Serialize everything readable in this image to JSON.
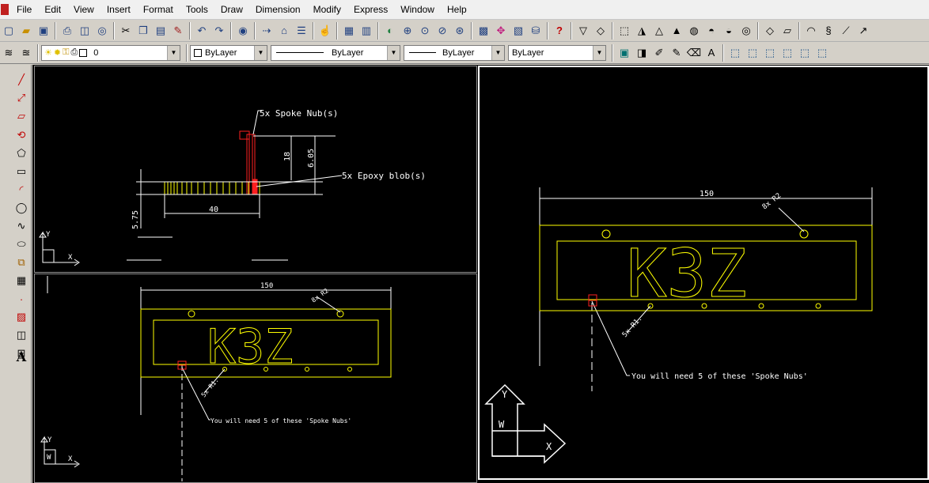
{
  "menu": [
    "File",
    "Edit",
    "View",
    "Insert",
    "Format",
    "Tools",
    "Draw",
    "Dimension",
    "Modify",
    "Express",
    "Window",
    "Help"
  ],
  "toolbar_icons": [
    "new-icon",
    "open-icon",
    "save-icon",
    "plot-icon",
    "preview-icon",
    "publish-icon",
    "cut-icon",
    "copy-icon",
    "paste-icon",
    "matchprop-icon",
    "undo-icon",
    "redo-icon",
    "web-icon",
    "hyperlink-icon",
    "block-icon",
    "properties-icon",
    "pan-icon",
    "zoom-realtime-icon",
    "zoom-window-icon",
    "zoom-previous-icon",
    "designcenter-icon",
    "toolpalette-icon",
    "dbconnect-icon",
    "help-icon"
  ],
  "properties": {
    "layer": "0",
    "color": "ByLayer",
    "linetype": "ByLayer",
    "lineweight": "ByLayer",
    "plotstyle": "ByLayer"
  },
  "viewport_top_left": {
    "dim_40": "40",
    "dim_18": "18",
    "dim_605": "6.05",
    "dim_575": "5.75",
    "callout_nubs": "5x Spoke Nub(s)",
    "callout_epoxy": "5x Epoxy blob(s)"
  },
  "viewport_bottom_left": {
    "dim_150": "150",
    "logo_text": "K3Z",
    "dim_r2": "8x R2",
    "dim_r1": "5x R1.",
    "note": "You will need 5 of these 'Spoke Nubs'"
  },
  "viewport_right": {
    "dim_150": "150",
    "logo_text": "K3Z",
    "dim_r2": "8x R2",
    "dim_r1": "5x R1.",
    "note": "You will need 5 of these 'Spoke Nubs'"
  },
  "ucs": {
    "x": "X",
    "y": "Y",
    "w": "W"
  },
  "colors": {
    "geometry": "#ffff00",
    "nub": "#ff2020",
    "text": "#ffffff",
    "background": "#000000"
  }
}
